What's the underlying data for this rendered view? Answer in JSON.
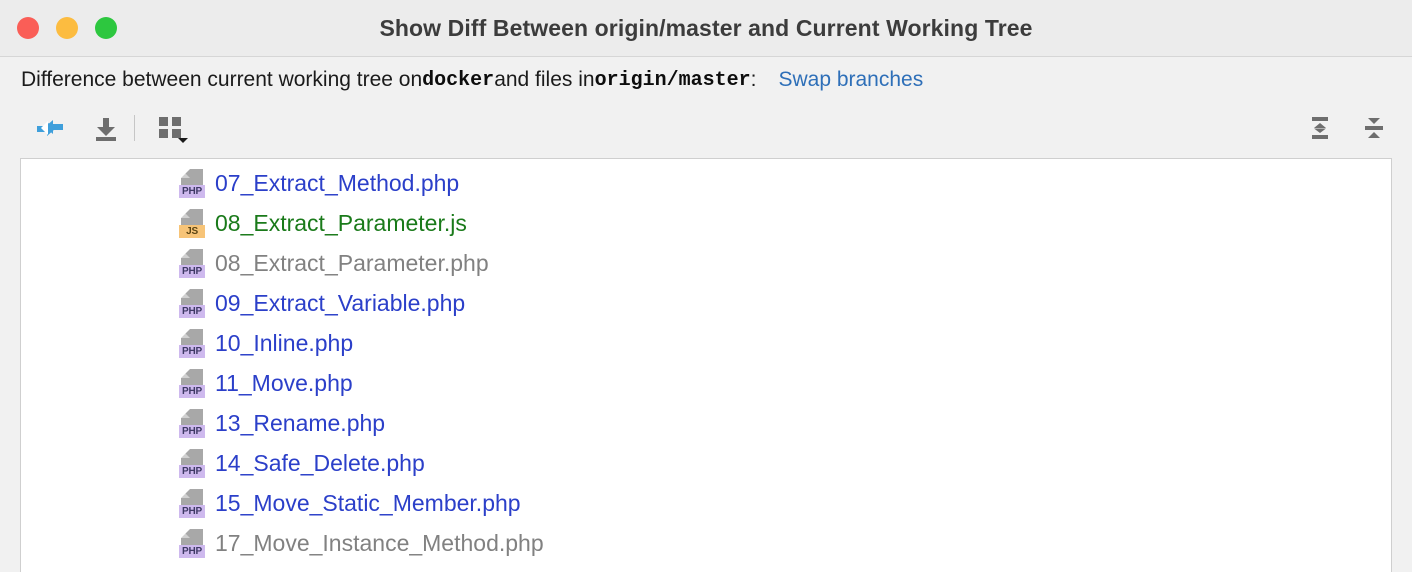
{
  "window": {
    "title": "Show Diff Between origin/master and Current Working Tree",
    "controls": {
      "close": "close-button",
      "minimize": "minimize-button",
      "maximize": "maximize-button"
    }
  },
  "subtitle": {
    "prefix": "Difference between current working tree on ",
    "source_branch": "docker",
    "middle": " and files in ",
    "target_branch": "origin/master",
    "suffix": ":",
    "swap_link": "Swap branches"
  },
  "toolbar": {
    "left": [
      {
        "name": "show-diff-button",
        "icon": "compare-arrows-icon"
      },
      {
        "name": "download-button",
        "icon": "download-icon"
      },
      {
        "name": "group-by-button",
        "icon": "grid-dropdown-icon"
      }
    ],
    "right": [
      {
        "name": "expand-all-button",
        "icon": "expand-all-icon"
      },
      {
        "name": "collapse-all-button",
        "icon": "collapse-all-icon"
      }
    ]
  },
  "file_list": {
    "items": [
      {
        "name": "07_Extract_Method.php",
        "type": "PHP",
        "status": "modified"
      },
      {
        "name": "08_Extract_Parameter.js",
        "type": "JS",
        "status": "added"
      },
      {
        "name": "08_Extract_Parameter.php",
        "type": "PHP",
        "status": "none"
      },
      {
        "name": "09_Extract_Variable.php",
        "type": "PHP",
        "status": "modified"
      },
      {
        "name": "10_Inline.php",
        "type": "PHP",
        "status": "modified"
      },
      {
        "name": "11_Move.php",
        "type": "PHP",
        "status": "modified"
      },
      {
        "name": "13_Rename.php",
        "type": "PHP",
        "status": "modified"
      },
      {
        "name": "14_Safe_Delete.php",
        "type": "PHP",
        "status": "modified"
      },
      {
        "name": "15_Move_Static_Member.php",
        "type": "PHP",
        "status": "modified"
      },
      {
        "name": "17_Move_Instance_Method.php",
        "type": "PHP",
        "status": "none"
      }
    ]
  },
  "colors": {
    "modified": "#2b3fc9",
    "added": "#1a7a1a",
    "unchanged": "#818181",
    "link": "#2e6fb8",
    "title": "#3c3c3c",
    "traffic_close": "#fa5e57",
    "traffic_min": "#fcbc40",
    "traffic_max": "#2dc73f",
    "php_badge": "#ceb9ee",
    "js_badge": "#f7c478"
  }
}
